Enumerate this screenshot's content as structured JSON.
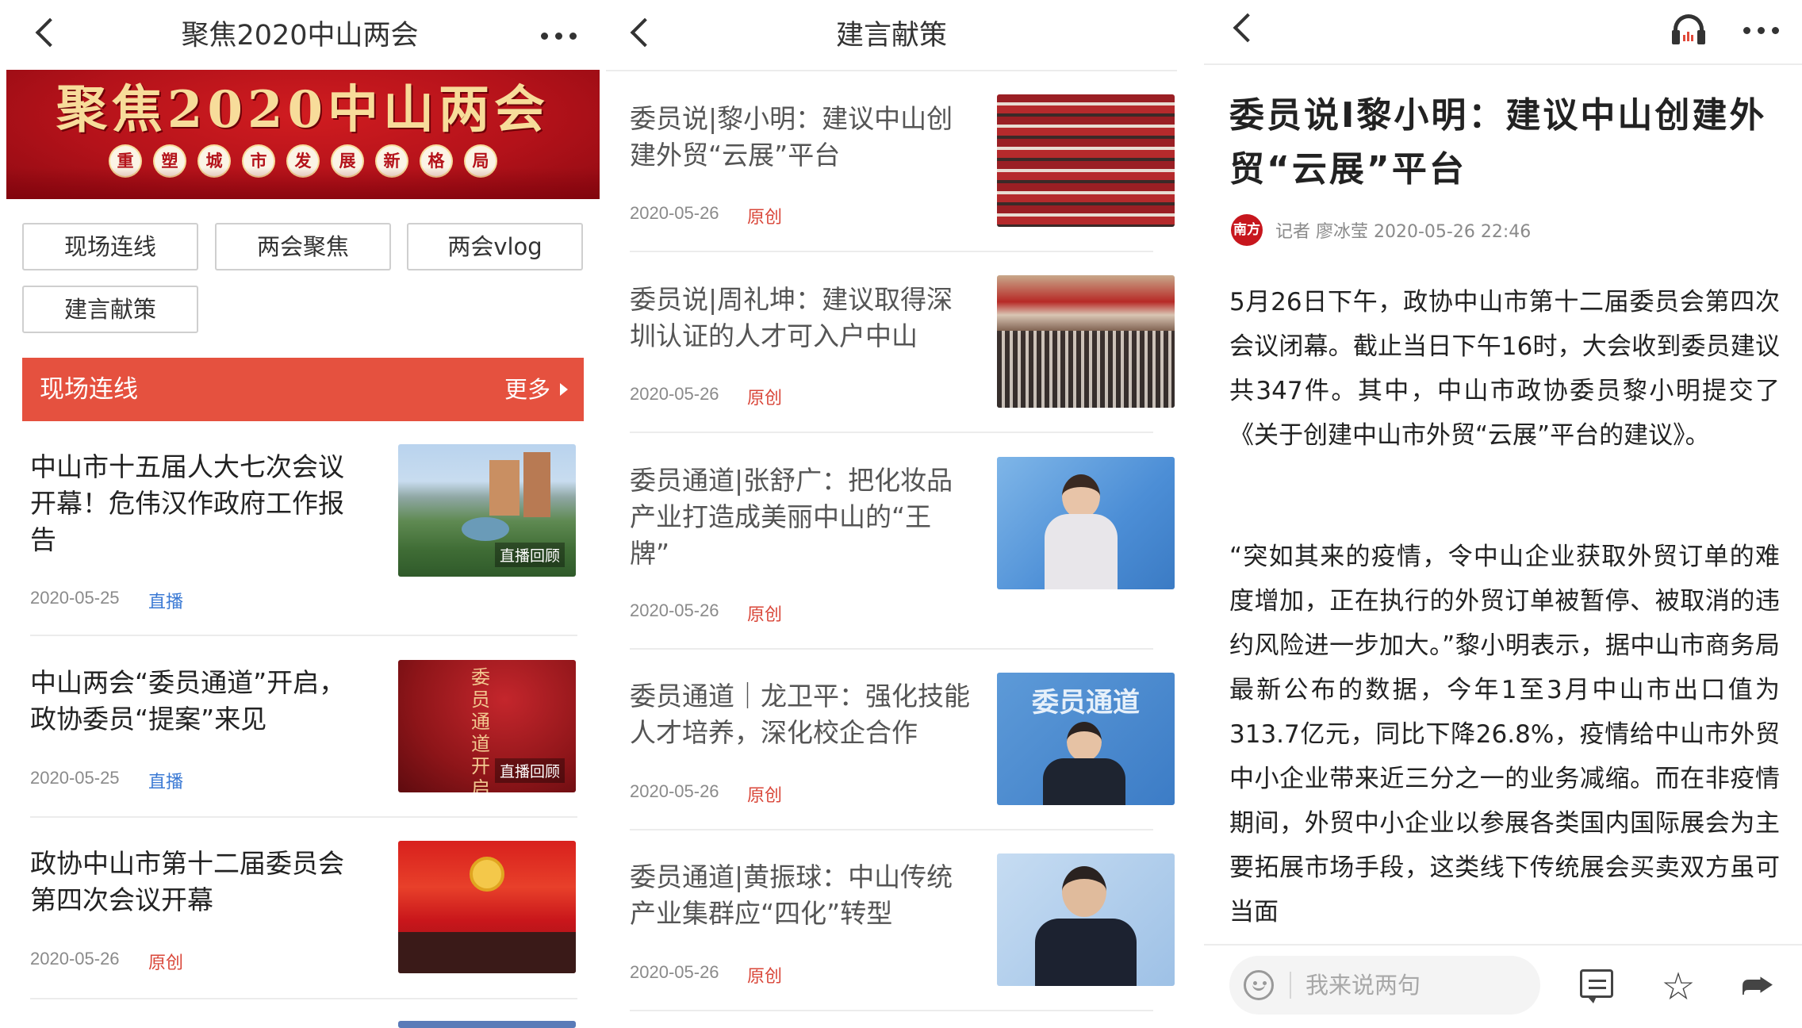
{
  "screen1": {
    "title": "聚焦2020中山两会",
    "banner": {
      "title": "聚焦2020中山两会",
      "subtitle_chars": [
        "重",
        "塑",
        "城",
        "市",
        "发",
        "展",
        "新",
        "格",
        "局"
      ]
    },
    "categories": [
      "现场连线",
      "两会聚焦",
      "两会vlog",
      "建言献策"
    ],
    "section": {
      "title": "现场连线",
      "more": "更多"
    },
    "news": [
      {
        "title": "中山市十五届人大七次会议开幕！危伟汉作政府工作报告",
        "date": "2020-05-25",
        "tag": "直播",
        "badge": "直播回顾"
      },
      {
        "title": "中山两会“委员通道”开启，政协委员“提案”来见",
        "date": "2020-05-25",
        "tag": "直播",
        "badge": "直播回顾",
        "thumb_text": "委员通道开启"
      },
      {
        "title": "政协中山市第十二届委员会第四次会议开幕",
        "date": "2020-05-26",
        "tag": "原创"
      }
    ]
  },
  "screen2": {
    "title": "建言献策",
    "news": [
      {
        "title": "委员说|黎小明：建议中山创建外贸“云展”平台",
        "date": "2020-05-26",
        "tag": "原创"
      },
      {
        "title": "委员说|周礼坤：建议取得深圳认证的人才可入户中山",
        "date": "2020-05-26",
        "tag": "原创"
      },
      {
        "title": "委员通道|张舒广：把化妆品产业打造成美丽中山的“王牌”",
        "date": "2020-05-26",
        "tag": "原创"
      },
      {
        "title": "委员通道｜龙卫平：强化技能人才培养，深化校企合作",
        "date": "2020-05-26",
        "tag": "原创",
        "thumb_text": "委员通道"
      },
      {
        "title": "委员通道|黄振球：中山传统产业集群应“四化”转型",
        "date": "2020-05-26",
        "tag": "原创"
      }
    ]
  },
  "screen3": {
    "article_title": "委员说I黎小明：建议中山创建外贸“云展”平台",
    "logo_text": "南方+",
    "byline": "记者 廖冰莹  2020-05-26 22:46",
    "paragraphs": [
      "5月26日下午，政协中山市第十二届委员会第四次会议闭幕。截止当日下午16时，大会收到委员建议共347件。其中，中山市政协委员黎小明提交了《关于创建中山市外贸“云展”平台的建议》。",
      "“突如其来的疫情，令中山企业获取外贸订单的难度增加，正在执行的外贸订单被暂停、被取消的违约风险进一步加大。”黎小明表示，据中山市商务局最新公布的数据，今年1至3月中山市出口值为313.7亿元，同比下降26.8%，疫情给中山市外贸中小企业带来近三分之一的业务减缩。而在非疫情期间，外贸中小企业以参展各类国内国际展会为主要拓展市场手段，这类线下传统展会买卖双方虽可当面"
    ],
    "comment_placeholder": "我来说两句",
    "icons": [
      "headphone-icon",
      "more-icon",
      "smile-icon",
      "comment-icon",
      "star-icon",
      "share-icon"
    ]
  },
  "colors": {
    "accent_red": "#e5513f",
    "tag_blue": "#3a79d4",
    "tag_red": "#d9473a",
    "banner_red": "#b4121a",
    "banner_gold": "#f7dc9a"
  }
}
